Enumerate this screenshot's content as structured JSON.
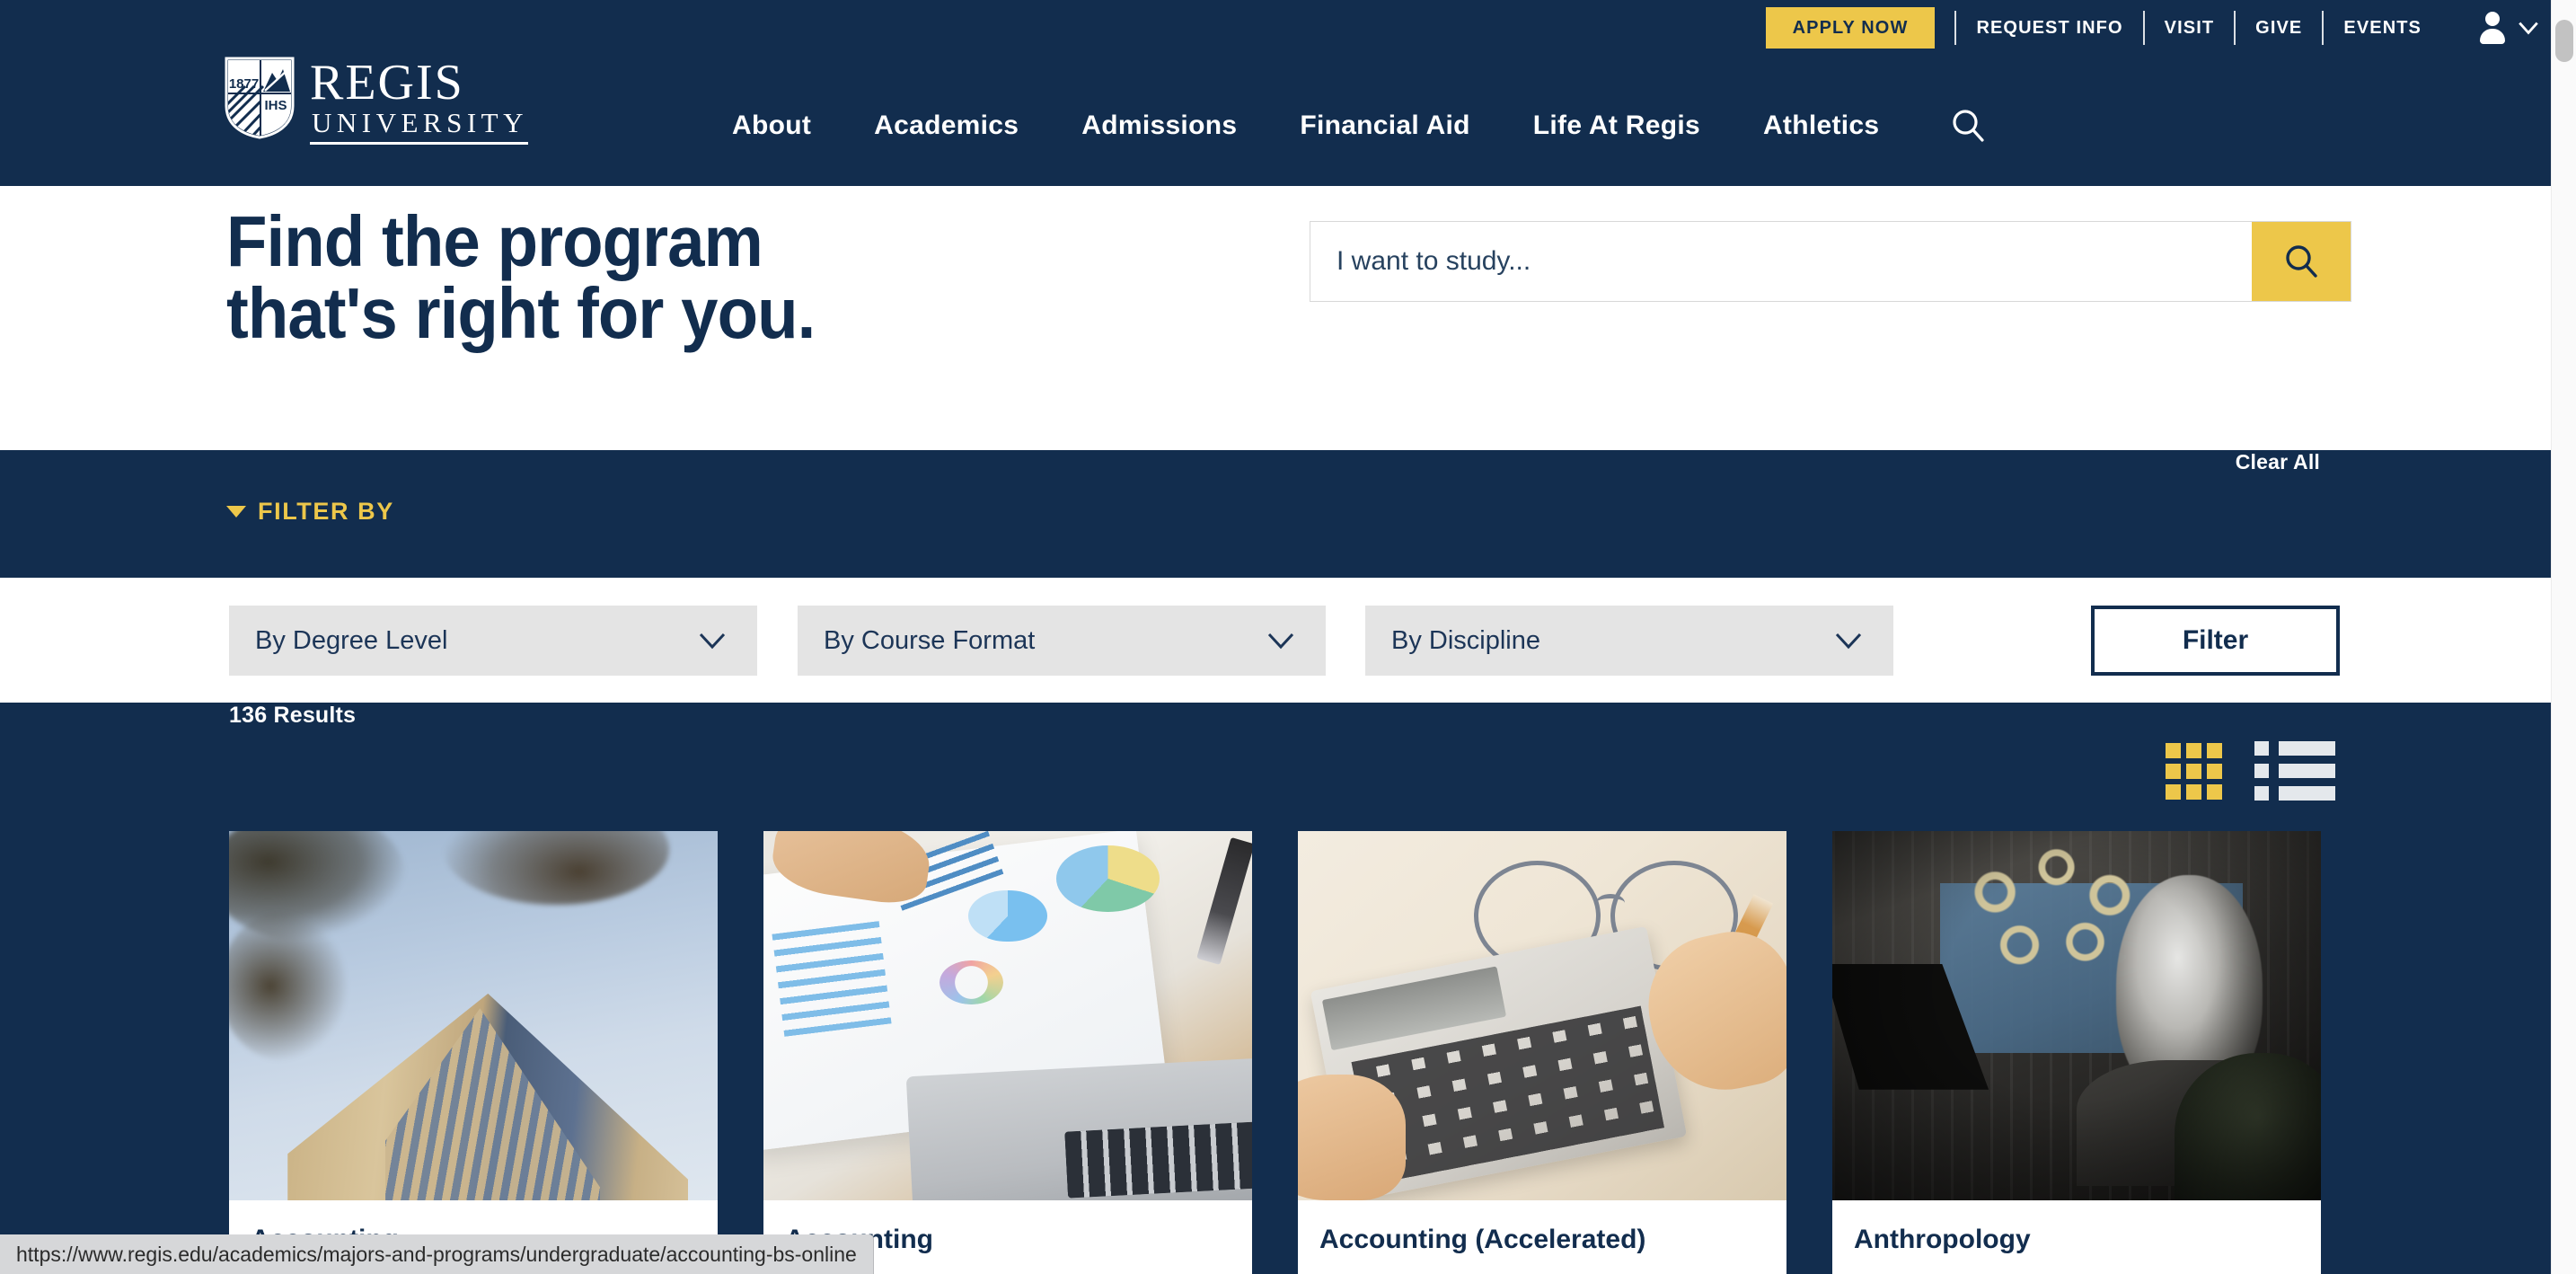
{
  "brand": {
    "navy": "#122D4E",
    "gold": "#EDC74A",
    "logo_name_line1": "REGIS",
    "logo_name_line2": "UNIVERSITY",
    "shield_year": "1877",
    "shield_motto": "IHS"
  },
  "utility_bar": {
    "apply_label": "APPLY NOW",
    "links": [
      {
        "label": "REQUEST INFO"
      },
      {
        "label": "VISIT"
      },
      {
        "label": "GIVE"
      },
      {
        "label": "EVENTS"
      }
    ],
    "account_icon": "user-icon",
    "account_chevron": "chevron-down-icon"
  },
  "main_nav": {
    "items": [
      {
        "label": "About"
      },
      {
        "label": "Academics"
      },
      {
        "label": "Admissions"
      },
      {
        "label": "Financial Aid"
      },
      {
        "label": "Life At Regis"
      },
      {
        "label": "Athletics"
      }
    ],
    "search_icon": "search-icon"
  },
  "hero": {
    "title_line1": "Find the program",
    "title_line2": "that's right for you.",
    "search_placeholder": "I want to study...",
    "search_value": "",
    "search_button_icon": "search-icon"
  },
  "filter_band": {
    "toggle_label": "FILTER BY",
    "toggle_icon": "triangle-down-icon",
    "clear_all_label": "Clear All"
  },
  "filter_controls": {
    "dropdowns": [
      {
        "label": "By Degree Level",
        "icon": "chevron-down-icon"
      },
      {
        "label": "By Course Format",
        "icon": "chevron-down-icon"
      },
      {
        "label": "By Discipline",
        "icon": "chevron-down-icon"
      }
    ],
    "filter_button_label": "Filter"
  },
  "results": {
    "count_label": "136 Results",
    "grid_view_icon": "grid-view-icon",
    "list_view_icon": "list-view-icon",
    "active_view": "grid",
    "cards": [
      {
        "title": "Accounting",
        "image_alt": "regis-building-against-sky"
      },
      {
        "title": "Accounting",
        "image_alt": "charts-documents-laptop-desk"
      },
      {
        "title": "Accounting (Accelerated)",
        "image_alt": "calculator-pencil-glasses"
      },
      {
        "title": "Anthropology",
        "image_alt": "graffiti-mural-portrait"
      }
    ]
  },
  "status_bar": {
    "url": "https://www.regis.edu/academics/majors-and-programs/undergraduate/accounting-bs-online"
  }
}
